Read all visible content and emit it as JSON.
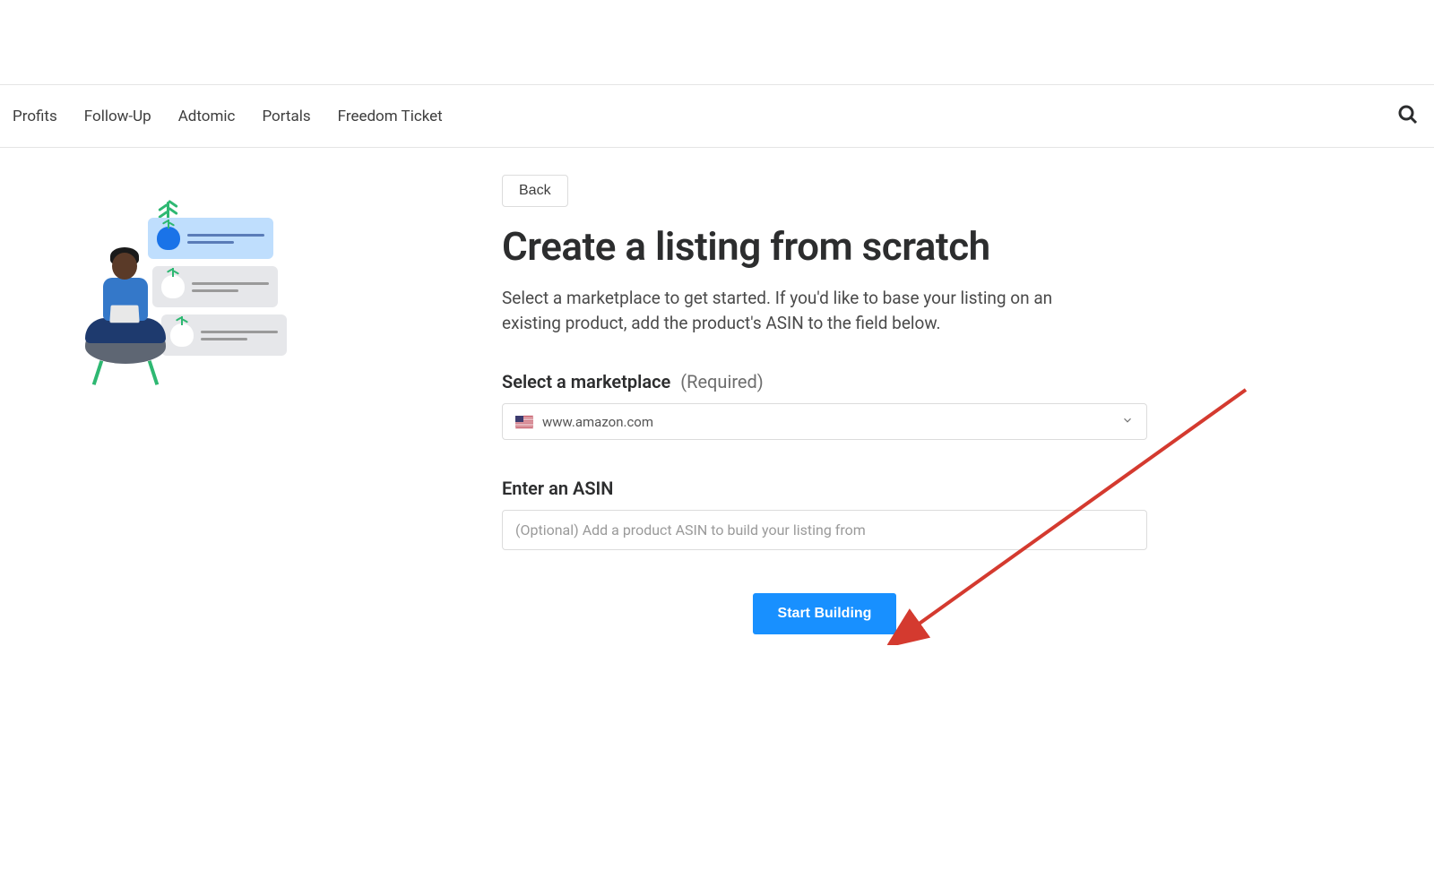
{
  "nav": {
    "items": [
      "Profits",
      "Follow-Up",
      "Adtomic",
      "Portals",
      "Freedom Ticket"
    ]
  },
  "page": {
    "back_label": "Back",
    "title": "Create a listing from scratch",
    "description": "Select a marketplace to get started. If you'd like to base your listing on an existing product, add the product's ASIN to the field below."
  },
  "marketplace": {
    "label": "Select a marketplace",
    "suffix": "(Required)",
    "selected": "www.amazon.com",
    "flag_country": "us"
  },
  "asin": {
    "label": "Enter an ASIN",
    "placeholder": "(Optional) Add a product ASIN to build your listing from",
    "value": ""
  },
  "cta": {
    "label": "Start Building"
  },
  "colors": {
    "accent": "#1890ff",
    "arrow": "#d43a2f"
  }
}
